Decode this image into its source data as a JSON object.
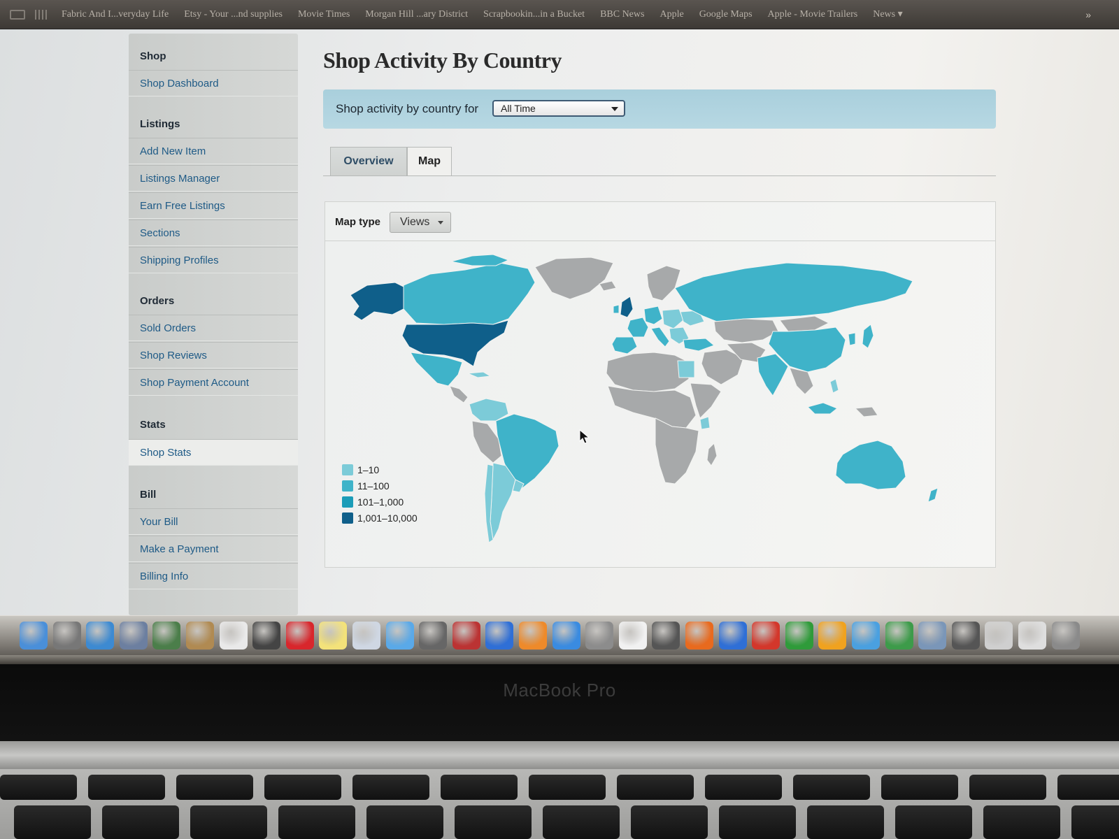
{
  "bookmarks": [
    "Fabric And I...veryday Life",
    "Etsy - Your ...nd supplies",
    "Movie Times",
    "Morgan Hill ...ary District",
    "Scrapbookin...in a Bucket",
    "BBC News",
    "Apple",
    "Google Maps",
    "Apple - Movie Trailers",
    "News ▾"
  ],
  "bookmarks_more": "»",
  "sidebar": {
    "sections": [
      {
        "heading": "Shop",
        "items": [
          "Shop Dashboard"
        ]
      },
      {
        "heading": "Listings",
        "items": [
          "Add New Item",
          "Listings Manager",
          "Earn Free Listings",
          "Sections",
          "Shipping Profiles"
        ]
      },
      {
        "heading": "Orders",
        "items": [
          "Sold Orders",
          "Shop Reviews",
          "Shop Payment Account"
        ]
      },
      {
        "heading": "Stats",
        "items": [
          "Shop Stats"
        ]
      },
      {
        "heading": "Bill",
        "items": [
          "Your Bill",
          "Make a Payment",
          "Billing Info"
        ]
      }
    ],
    "active_item": "Shop Stats"
  },
  "page": {
    "title": "Shop Activity By Country",
    "filter_label": "Shop activity by country for",
    "period_value": "All Time"
  },
  "tabs": {
    "overview": "Overview",
    "map": "Map",
    "active": "Map"
  },
  "map": {
    "type_label": "Map type",
    "type_value": "Views",
    "legend": [
      {
        "label": "1–10",
        "color": "#7ccbd8"
      },
      {
        "label": "11–100",
        "color": "#3fb3c9"
      },
      {
        "label": "101–1,000",
        "color": "#1b9cb8"
      },
      {
        "label": "1,001–10,000",
        "color": "#0f5f8a"
      }
    ],
    "no_data_color": "#a7a9aa"
  },
  "dock": {
    "icons": [
      "finder-icon",
      "launchpad-icon",
      "safari-icon",
      "mail-icon",
      "iphoto-icon",
      "address-book-icon",
      "calendar-icon",
      "photo-booth-icon",
      "acrobat-icon",
      "stickies-icon",
      "preview-icon",
      "messages-icon",
      "facetime-icon",
      "photo-icon",
      "itunes-icon",
      "ibooks-icon",
      "app-store-icon",
      "system-preferences-icon",
      "textedit-icon",
      "unknown-app-icon",
      "firefox-icon",
      "word-icon",
      "powerpoint-icon",
      "excel-icon",
      "outlook-icon",
      "messenger-icon",
      "downloads-icon",
      "network-icon",
      "unknown-app-icon",
      "printer-icon",
      "documents-icon",
      "trash-icon"
    ]
  },
  "laptop": {
    "brand": "MacBook Pro"
  }
}
